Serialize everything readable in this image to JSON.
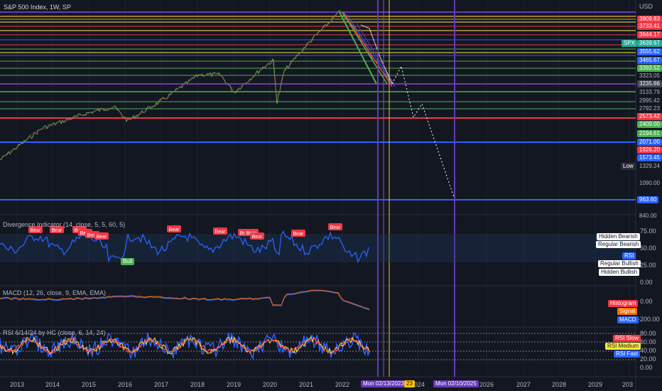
{
  "header": {
    "title": "S&P 500 Index, 1W, SP",
    "currency": "USD"
  },
  "colors": {
    "background": "#131722",
    "grid": "#1e222d",
    "axis_text": "#b2b5be",
    "price_line": "#4caf50",
    "red": "#f23645",
    "green": "#22ab94",
    "blue": "#2962ff",
    "purple": "#673ab7",
    "yellow": "#ffc107",
    "rsi_blue": "#2962ff",
    "rsi_red": "#ff5252",
    "rsi_yellow": "#ffeb3b"
  },
  "price_axis": {
    "labels": [
      {
        "text": "3809.83",
        "color": "#f23645"
      },
      {
        "text": "3733.41",
        "color": "#f23645"
      },
      {
        "text": "3644.17",
        "color": "#f23645"
      },
      {
        "text": "3639.67",
        "color": "#22ab94",
        "prefix": "SPX"
      },
      {
        "text": "3555.62",
        "color": "#2962ff"
      },
      {
        "text": "3465.67",
        "color": "#2962ff"
      },
      {
        "text": "3393.52",
        "color": "#4caf50"
      },
      {
        "text": "3323.05",
        "color": "#131722"
      },
      {
        "text": "3235.66",
        "color": "#434651"
      },
      {
        "text": "3133.79",
        "color": "#131722"
      },
      {
        "text": "2995.42",
        "color": "#131722"
      },
      {
        "text": "2792.23",
        "color": "#131722"
      },
      {
        "text": "2573.42",
        "color": "#f23645"
      },
      {
        "text": "2409.00",
        "color": "#4caf50"
      },
      {
        "text": "2194.61",
        "color": "#4caf50"
      },
      {
        "text": "2071.00",
        "color": "#2962ff"
      },
      {
        "text": "1926.20",
        "color": "#f23645"
      },
      {
        "text": "1573.45",
        "color": "#2962ff"
      },
      {
        "text": "1329.24",
        "color": "#131722",
        "prefix": "Low"
      },
      {
        "text": "1090.00",
        "color": "#131722"
      },
      {
        "text": "963.60",
        "color": "#2962ff"
      },
      {
        "text": "840.00",
        "color": "#131722"
      }
    ]
  },
  "divergence": {
    "title": "Divergence Indicator (14, close, 5, 5, 60, 5)",
    "axis": [
      "75.00",
      "50.00",
      "25.00",
      "0.00"
    ],
    "legend": [
      "Hidden Bearish",
      "Regular Bearish",
      "RSI",
      "Regular Bullish",
      "Hidden Bullish"
    ],
    "bear_label": "Bear",
    "bull_label": "Bull"
  },
  "macd": {
    "title": "MACD (12, 26, close, 9, EMA, EMA)",
    "axis": [
      "0.00",
      "-200.00"
    ],
    "legend": [
      "Histogram",
      "Signal",
      "MACD"
    ]
  },
  "rsi": {
    "title": "RSI 6/14/24 by HC (close, 6, 14, 24)",
    "axis": [
      "80.00",
      "60.00",
      "40.00",
      "20.00",
      "0.00"
    ],
    "legend": [
      "RSI Slow",
      "RSI Medium",
      "RSI Fast"
    ]
  },
  "time_axis": {
    "years": [
      "2013",
      "2014",
      "2015",
      "2016",
      "2017",
      "2018",
      "2019",
      "2020",
      "2021",
      "2022",
      "2024",
      "2026",
      "2027",
      "2028",
      "2029",
      "203"
    ],
    "marker_1": "Mon 02/13/2023",
    "marker_1_partial": "23",
    "marker_2": "Mon 02/10/2025"
  }
}
